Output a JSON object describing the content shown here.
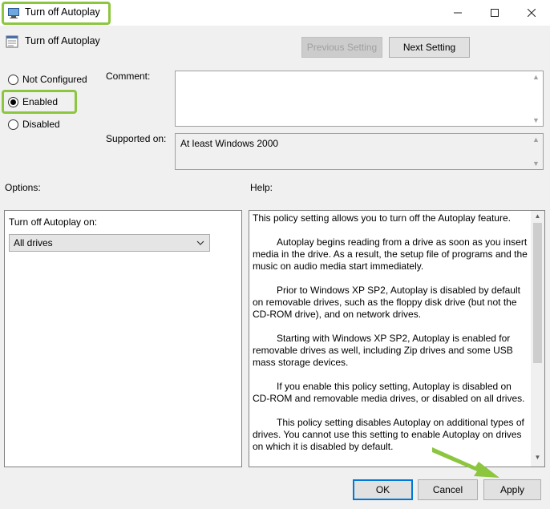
{
  "window": {
    "title": "Turn off Autoplay",
    "highlight_color": "#8cc63f"
  },
  "header": {
    "policy_name": "Turn off Autoplay",
    "previous_setting": "Previous Setting",
    "next_setting": "Next Setting"
  },
  "state": {
    "options": [
      {
        "label": "Not Configured",
        "selected": false
      },
      {
        "label": "Enabled",
        "selected": true
      },
      {
        "label": "Disabled",
        "selected": false
      }
    ]
  },
  "comment": {
    "label": "Comment:",
    "value": ""
  },
  "supported": {
    "label": "Supported on:",
    "value": "At least Windows 2000"
  },
  "options_panel": {
    "label": "Options:",
    "field_label": "Turn off Autoplay on:",
    "selected_value": "All drives"
  },
  "help_panel": {
    "label": "Help:",
    "paragraphs": [
      "This policy setting allows you to turn off the Autoplay feature.",
      "Autoplay begins reading from a drive as soon as you insert media in the drive. As a result, the setup file of programs and the music on audio media start immediately.",
      "Prior to Windows XP SP2, Autoplay is disabled by default on removable drives, such as the floppy disk drive (but not the CD-ROM drive), and on network drives.",
      "Starting with Windows XP SP2, Autoplay is enabled for removable drives as well, including Zip drives and some USB mass storage devices.",
      "If you enable this policy setting, Autoplay is disabled on CD-ROM and removable media drives, or disabled on all drives.",
      "This policy setting disables Autoplay on additional types of drives. You cannot use this setting to enable Autoplay on drives on which it is disabled by default."
    ]
  },
  "footer": {
    "ok": "OK",
    "cancel": "Cancel",
    "apply": "Apply"
  }
}
